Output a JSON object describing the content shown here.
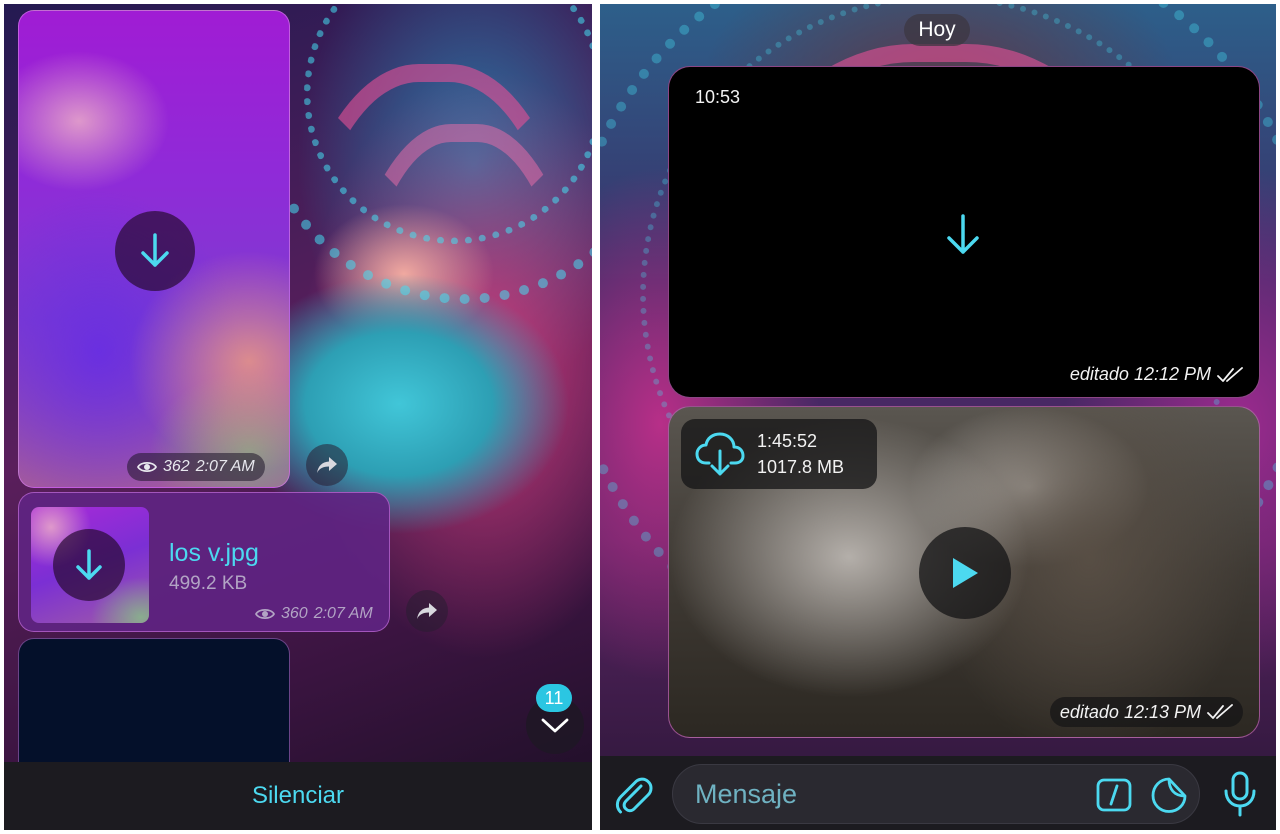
{
  "left_screen": {
    "photo_message": {
      "views": "362",
      "time": "2:07 AM"
    },
    "file_message": {
      "file_name": "los v.jpg",
      "file_size": "499.2 KB",
      "views": "360",
      "time": "2:07 AM"
    },
    "unread_count": "11",
    "bottom_action": "Silenciar"
  },
  "right_screen": {
    "date_separator": "Hoy",
    "video_message_1": {
      "timestamp": "10:53",
      "edited_label": "editado 12:12 PM"
    },
    "video_message_2": {
      "duration": "1:45:52",
      "size": "1017.8 MB",
      "edited_label": "editado 12:13 PM"
    },
    "composer": {
      "placeholder": "Mensaje"
    }
  },
  "colors": {
    "accent": "#4cd9f0",
    "badge": "#2bc6e2",
    "bar_background": "#1c1b20"
  },
  "icons": [
    "download-arrow-icon",
    "eye-icon",
    "share-arrow-icon",
    "chevron-down-icon",
    "cloud-download-icon",
    "play-icon",
    "double-check-icon",
    "paperclip-icon",
    "slash-command-icon",
    "sticker-icon",
    "microphone-icon"
  ]
}
